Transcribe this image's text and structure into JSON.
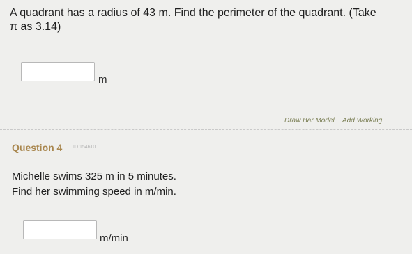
{
  "question3": {
    "line1": "A quadrant has a radius of 43 m. Find the perimeter of the quadrant. (Take",
    "line2": "π as 3.14)",
    "answer_value": "",
    "unit": "m"
  },
  "tools": {
    "draw_bar_model": "Draw Bar Model",
    "add_working": "Add Working"
  },
  "question4": {
    "heading": "Question 4",
    "id_label": "ID 154610",
    "line1": "Michelle swims 325 m in 5 minutes.",
    "line2": "Find her swimming speed in m/min.",
    "answer_value": "",
    "unit": "m/min"
  }
}
